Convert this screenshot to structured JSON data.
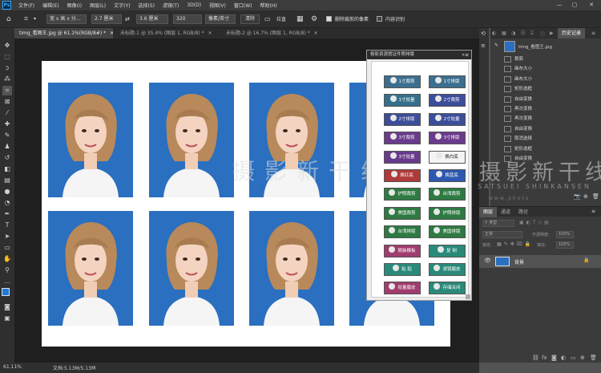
{
  "menu": {
    "logo": "Ps",
    "items": [
      "文件(F)",
      "编辑(E)",
      "图像(I)",
      "图层(L)",
      "文字(Y)",
      "选择(S)",
      "滤镜(T)",
      "3D(D)",
      "视图(V)",
      "窗口(W)",
      "帮助(H)"
    ],
    "minimize": "—",
    "maximize": "▢",
    "close": "✕"
  },
  "options": {
    "ratio": "宽 x 高 x 分...",
    "width": "2.7 厘米",
    "height": "3.6 厘米",
    "resolution": "320",
    "unit": "像素/英寸",
    "clear": "清除",
    "straighten": "拉直",
    "delete_cropped": "删除裁剪的像素",
    "content_aware": "内容识别"
  },
  "tabs": [
    {
      "label": "timg_看图王.jpg @ 61.1%(RGB/8#) *",
      "close": "✕"
    },
    {
      "label": "未标题-1 @ 35.4% (图层 1, RGB/8) *",
      "close": "✕"
    },
    {
      "label": "未标题-2 @ 16.7% (图层 1, RGB/8) *",
      "close": "✕"
    }
  ],
  "plugin": {
    "title": "极影资源馆证件照排版",
    "buttons": [
      {
        "label": "1寸裁剪",
        "color": "#3c6f8f"
      },
      {
        "label": "1寸排版",
        "color": "#3c6f8f"
      },
      {
        "label": "1寸批量",
        "color": "#34708c"
      },
      {
        "label": "2寸裁剪",
        "color": "#3c4d9a"
      },
      {
        "label": "2寸排版",
        "color": "#3c4d9a"
      },
      {
        "label": "2寸批量",
        "color": "#3c4d9a"
      },
      {
        "label": "3寸裁剪",
        "color": "#6a3b8c"
      },
      {
        "label": "3寸排版",
        "color": "#6a3b8c"
      },
      {
        "label": "3寸批量",
        "color": "#6a3b8c"
      },
      {
        "label": "换白底",
        "color": "#f4f4f4"
      },
      {
        "label": "换红底",
        "color": "#b03a3a"
      },
      {
        "label": "换蓝底",
        "color": "#2d58b0"
      },
      {
        "label": "护照裁剪",
        "color": "#2e7a42"
      },
      {
        "label": "台湾裁剪",
        "color": "#2e7a42"
      },
      {
        "label": "美国裁剪",
        "color": "#2e7a42"
      },
      {
        "label": "护照排版",
        "color": "#2e7a42"
      },
      {
        "label": "台湾排版",
        "color": "#2e7a42"
      },
      {
        "label": "美国排版",
        "color": "#2e7a42"
      },
      {
        "label": "随装模板",
        "color": "#a03c6e"
      },
      {
        "label": "复 制",
        "color": "#2a8a7a"
      },
      {
        "label": "粘 贴",
        "color": "#2a8a7a"
      },
      {
        "label": "滤镜磨皮",
        "color": "#2a8a7a"
      },
      {
        "label": "批量磨皮",
        "color": "#a03c6e"
      },
      {
        "label": "存储关闭",
        "color": "#2a8a7a"
      }
    ]
  },
  "watermark": {
    "canvas_text": "摄影新干线",
    "panel_text": "摄影新干线",
    "romaji": "SATSUEI SHINKANSEN",
    "url": "www.photo"
  },
  "history": {
    "tabs": [
      "历史记录"
    ],
    "snapshot": "timg_看图王.jpg",
    "items": [
      "裁剪",
      "画布大小",
      "画布大小",
      "矩形选框",
      "自由变换",
      "再次变换",
      "再次变换",
      "自由变换",
      "取消选择",
      "矩形选框",
      "自由变换"
    ]
  },
  "layers": {
    "tabs": [
      "图层",
      "通道",
      "路径"
    ],
    "kind": "类型",
    "blend": "正常",
    "opacity_label": "不透明度:",
    "opacity": "100%",
    "lock_label": "锁定:",
    "fill_label": "填充:",
    "fill": "100%",
    "layer_name": "背景"
  },
  "status": {
    "zoom": "61.11%",
    "doc": "文档:5.13M/5.13M"
  },
  "colors": {
    "photo_bg": "#2a6fc0",
    "foreground": "#1f7ad8",
    "background": "#ffffff"
  }
}
